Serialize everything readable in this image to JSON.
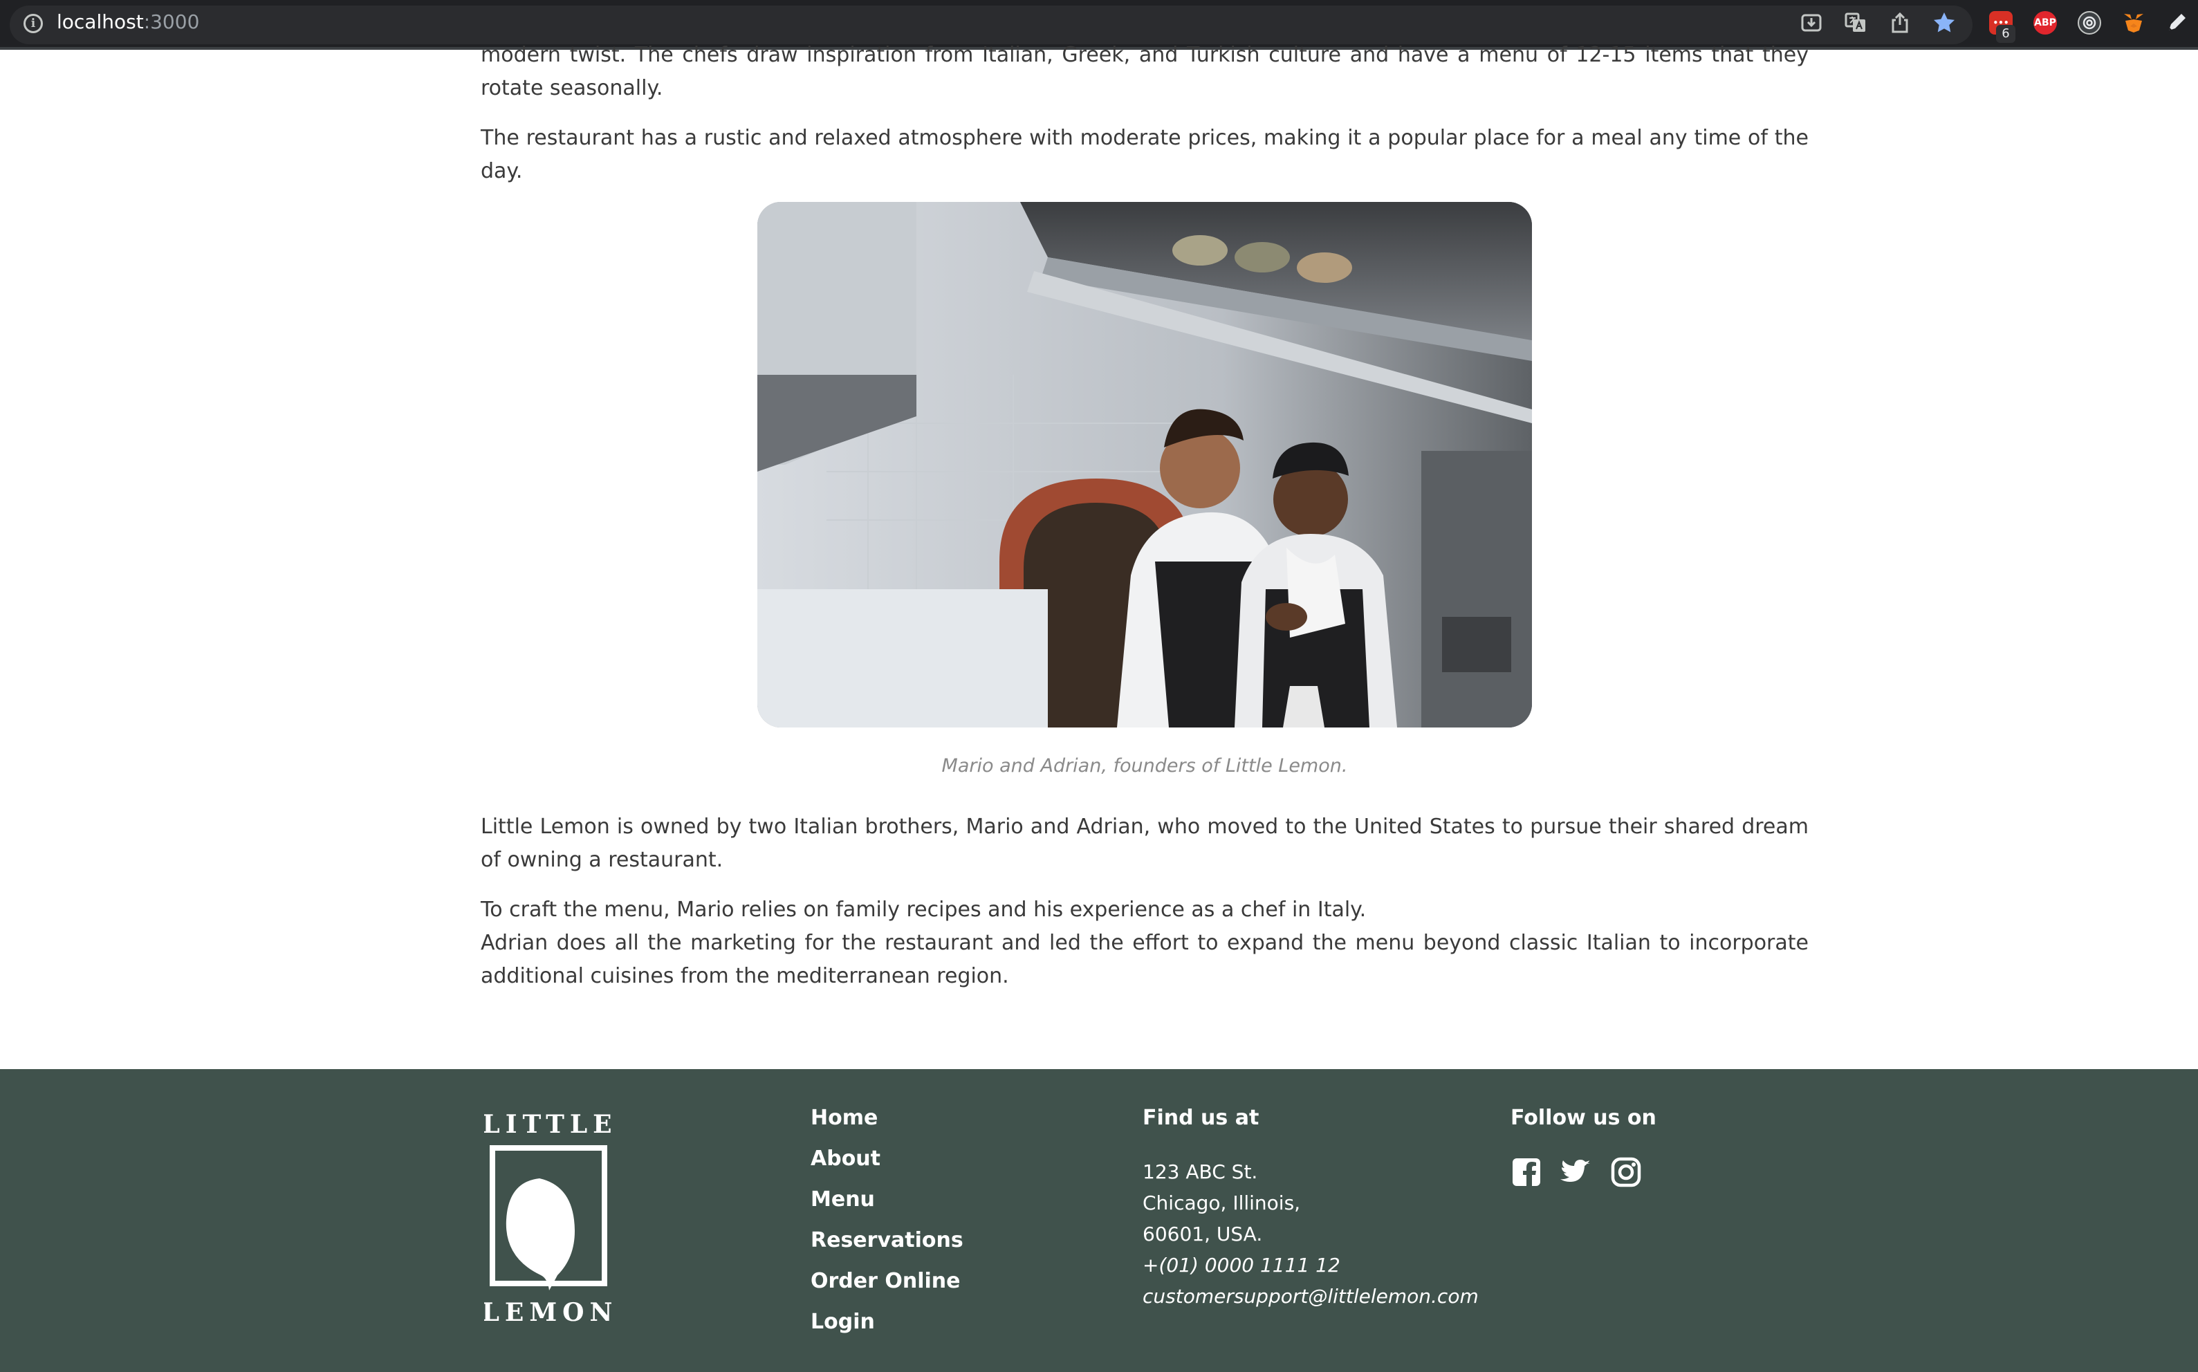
{
  "browser": {
    "url_host": "localhost",
    "url_port": ":3000",
    "extension_badge": "6",
    "extensions": [
      "ABP"
    ]
  },
  "article": {
    "top_paragraph_partial": "modern twist. The chefs draw inspiration from Italian, Greek, and Turkish culture and have a menu of 12-15 items that they rotate seasonally.",
    "atmosphere": "The restaurant has a rustic and relaxed atmosphere with moderate prices, making it a popular place for a meal any time of the day.",
    "image_alt": "Mario and Adrian in the kitchen",
    "caption": "Mario and Adrian, founders of Little Lemon.",
    "owned": "Little Lemon is owned by two Italian brothers, Mario and Adrian, who moved to the United States to pursue their shared dream of owning a restaurant.",
    "craft_line1": "To craft the menu, Mario relies on family recipes and his experience as a chef in Italy.",
    "craft_line2": "Adrian does all the marketing for the restaurant and led the effort to expand the menu beyond classic Italian to incorporate additional cuisines from the mediterranean region."
  },
  "footer": {
    "logo_top": "LITTLE",
    "logo_bottom": "LEMON",
    "nav": [
      {
        "label": "Home"
      },
      {
        "label": "About"
      },
      {
        "label": "Menu"
      },
      {
        "label": "Reservations"
      },
      {
        "label": "Order Online"
      },
      {
        "label": "Login"
      }
    ],
    "find_title": "Find us at",
    "address_line1": "123 ABC St.",
    "address_line2": "Chicago, Illinois,",
    "address_line3": "60601, USA.",
    "phone": "+(01) 0000 1111 12",
    "email": "customersupport@littlelemon.com",
    "follow_title": "Follow us on",
    "social": [
      "facebook-icon",
      "twitter-icon",
      "instagram-icon"
    ]
  },
  "colors": {
    "footer_bg": "#40524c",
    "chrome_bg": "#202124",
    "text": "#3a3a3a",
    "caption": "#8a8a8a"
  }
}
